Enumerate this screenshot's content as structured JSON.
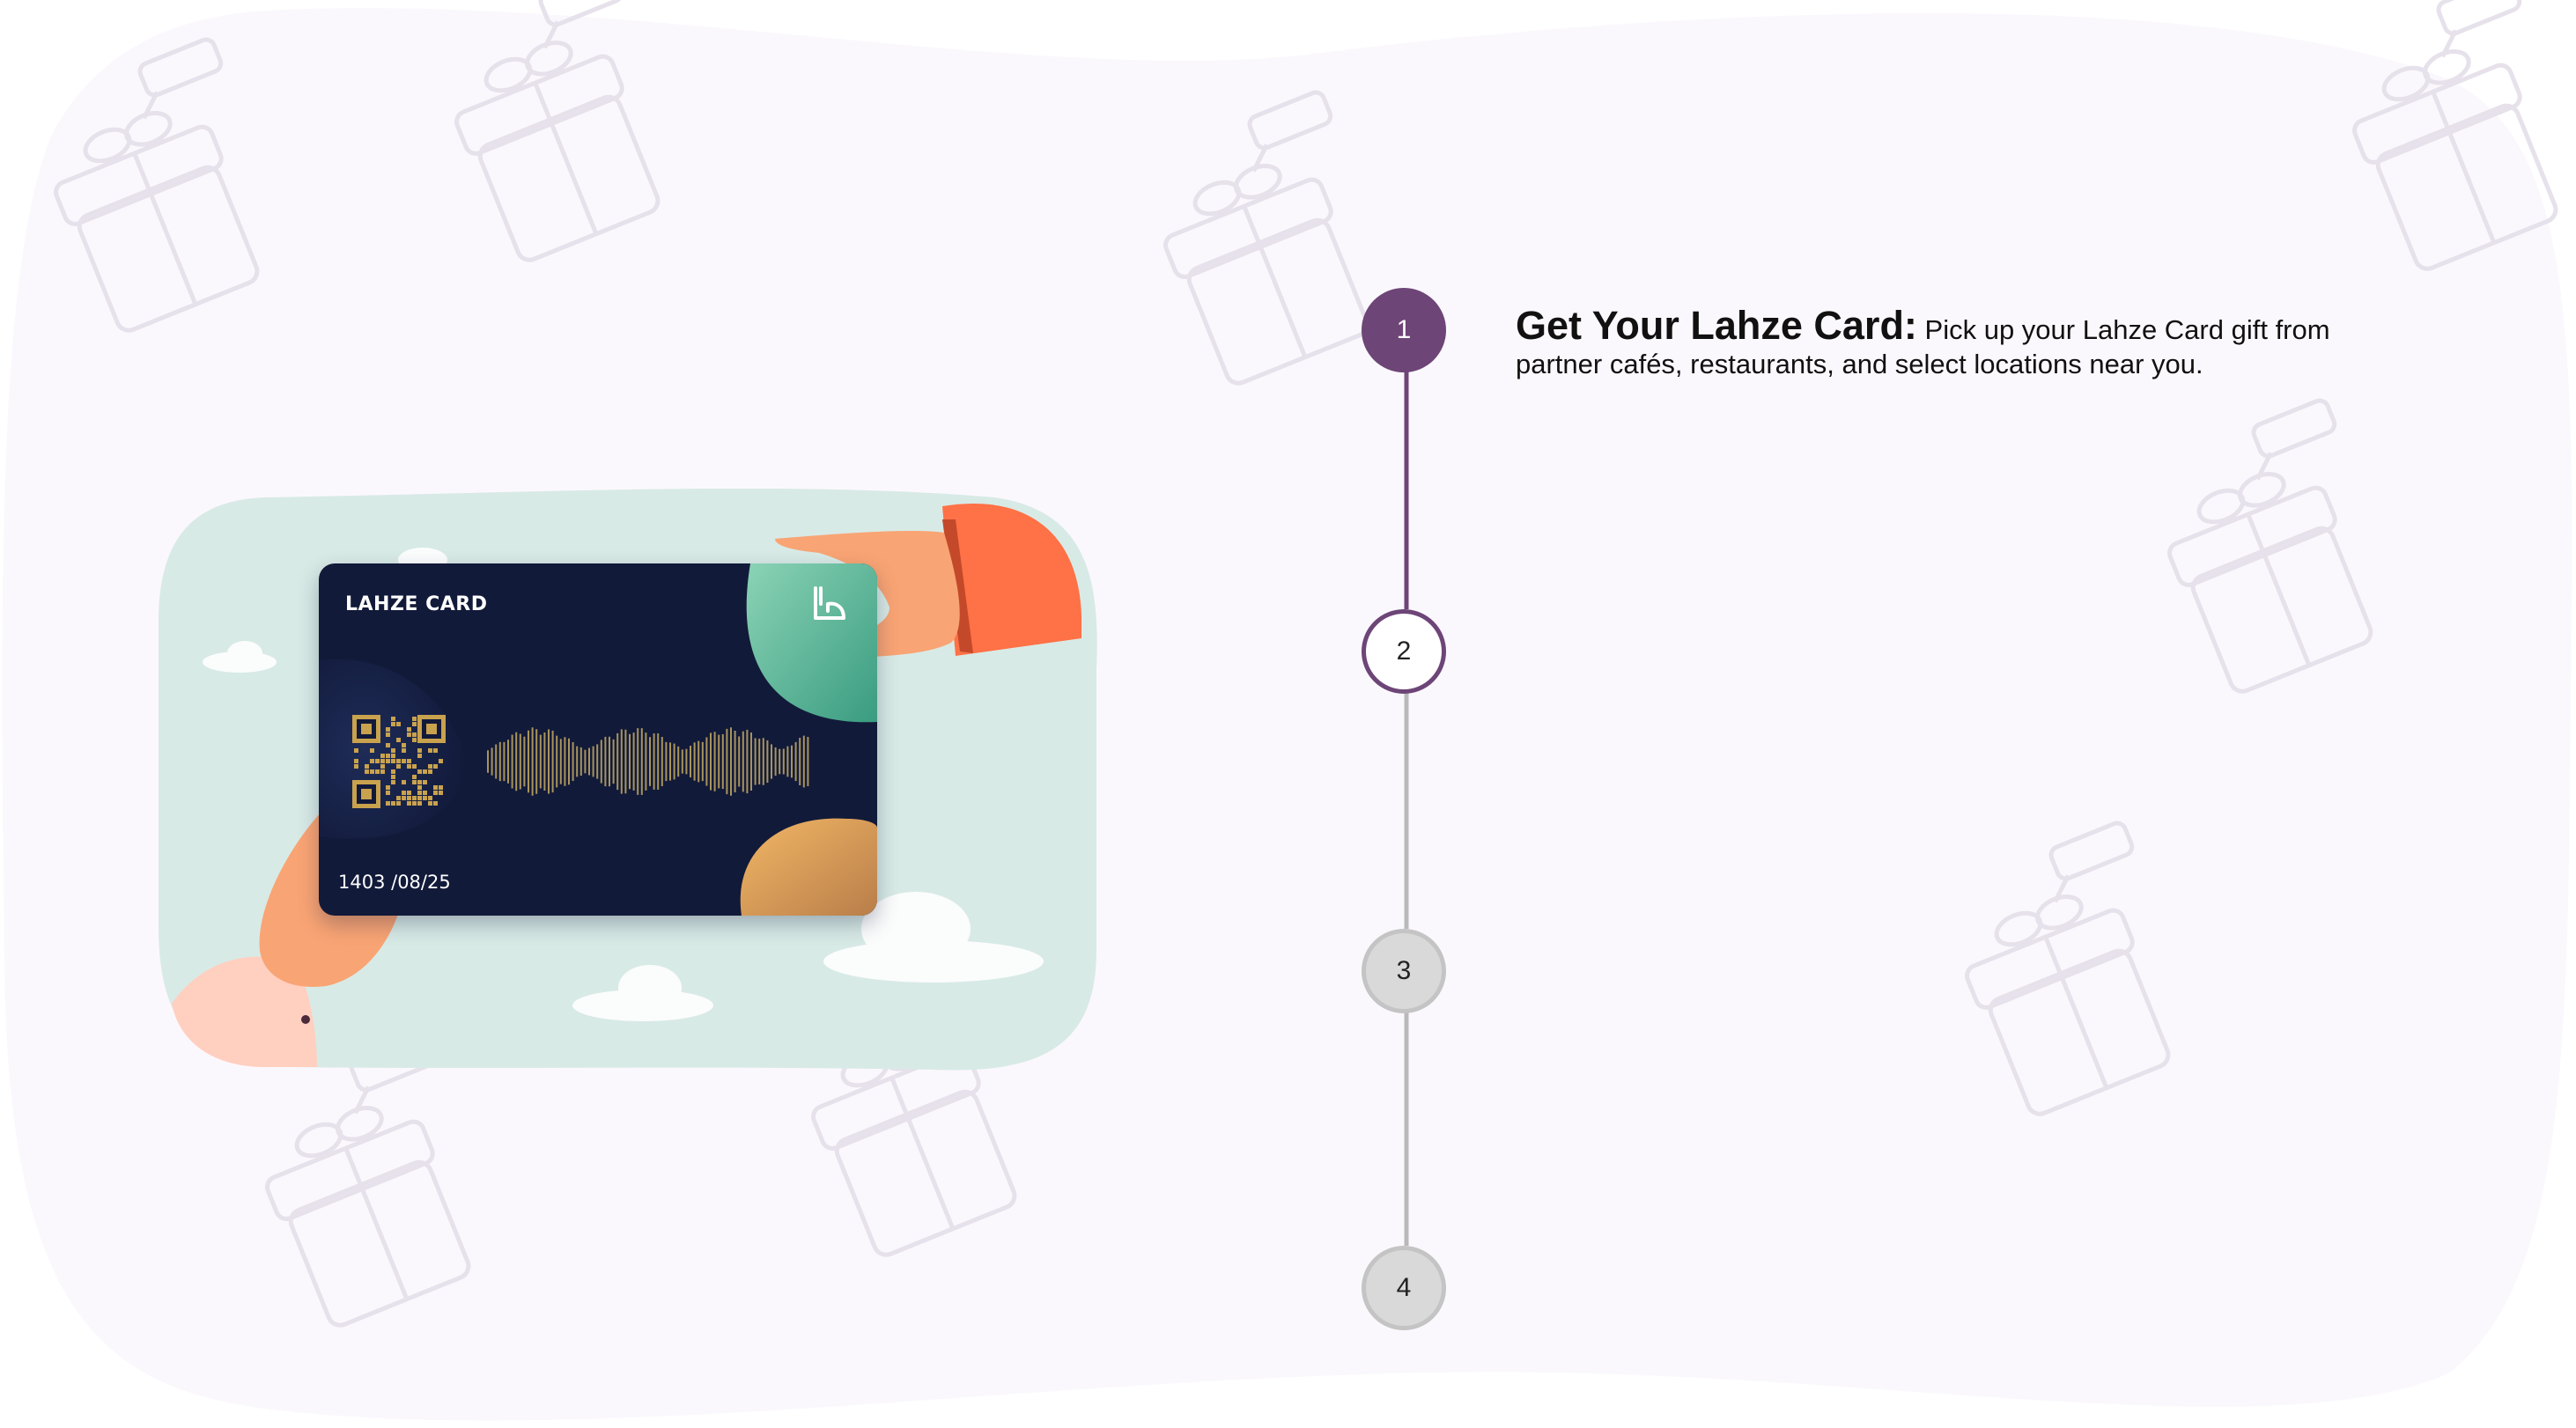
{
  "colors": {
    "background": "#fbf8fd",
    "accent": "#6d4577",
    "inactive": "#c4c4c4",
    "card": "#121a3a",
    "scene": "#d8eae6"
  },
  "card": {
    "title": "LAHZE CARD",
    "date": "1403 /08/25",
    "logo_icon": "lahze-logo-icon",
    "qr_icon": "qr-code-icon",
    "wave_icon": "sound-wave-icon"
  },
  "steps": [
    {
      "number": "1",
      "state": "active"
    },
    {
      "number": "2",
      "state": "current"
    },
    {
      "number": "3",
      "state": "inactive"
    },
    {
      "number": "4",
      "state": "inactive"
    }
  ],
  "step_detail": {
    "heading": "Get Your Lahze Card:",
    "body": " Pick up your Lahze Card gift from partner cafés, restaurants, and select locations near you."
  }
}
